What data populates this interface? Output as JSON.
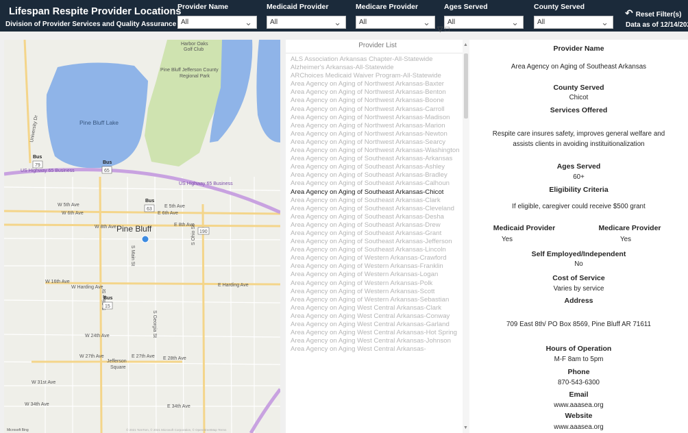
{
  "header": {
    "title": "Lifespan Respite Provider Locations",
    "subtitle": "Division of Provider Services and Quality Assurance",
    "reset_label": "Reset Filter(s)",
    "data_as_of": "Data as of 12/14/2021"
  },
  "slicers": [
    {
      "label": "Provider Name",
      "value": "All"
    },
    {
      "label": "Medicaid Provider",
      "value": "All"
    },
    {
      "label": "Medicare Provider",
      "value": "All"
    },
    {
      "label": "Ages Served",
      "value": "All"
    },
    {
      "label": "County Served",
      "value": "All"
    }
  ],
  "map": {
    "labels": {
      "harbor": "Harbor Oaks",
      "golf": "Golf Club",
      "park1": "Pine Bluff Jefferson County",
      "park2": "Regional Park",
      "lake": "Pine Bluff Lake",
      "city": "Pine Bluff",
      "hwy1": "US Highway 65 Business",
      "hwy2": "US Highway 65 Business",
      "w5": "W 5th Ave",
      "w6": "W 6th Ave",
      "e5": "E 5th Ave",
      "e6": "E 6th Ave",
      "w8": "W 8th Ave",
      "e8": "E 8th Ave",
      "w16": "W 16th Ave",
      "harding": "W Harding Ave",
      "eharding": "E Harding Ave",
      "w24": "W 24th Ave",
      "w27": "W 27th Ave",
      "e27": "E 27th Ave",
      "e28": "E 28th Ave",
      "jeff1": "Jefferson",
      "jeff2": "Square",
      "w31": "W 31st Ave",
      "w34": "W 34th Ave",
      "e34": "E 34th Ave",
      "univ": "University Dr",
      "mainst": "S Main St",
      "ohio": "S Ohio St",
      "olive": "S Olive St",
      "georgia": "S Georgia St",
      "bus": "Bus",
      "sh79": "79",
      "sh65": "65",
      "sh63": "63",
      "sh190": "190",
      "sh15": "15",
      "ms": "Microsoft Bing",
      "copyright": "© 2021 TomTom, © 2021 Microsoft Corporation, © OpenStreetMap Terms"
    }
  },
  "provider_list": {
    "header": "Provider List",
    "selected": "Area Agency on Aging of Southeast Arkansas-Chicot",
    "items": [
      "ALS Association Arkansas Chapter-All-Statewide",
      "Alzheimer's Arkansas-All-Statewide",
      "ARChoices Medicaid Waiver Program-All-Statewide",
      "Area Agency on Aging of Northwest Arkansas-Baxter",
      "Area Agency on Aging of Northwest Arkansas-Benton",
      "Area Agency on Aging of Northwest Arkansas-Boone",
      "Area Agency on Aging of Northwest Arkansas-Carroll",
      "Area Agency on Aging of Northwest Arkansas-Madison",
      "Area Agency on Aging of Northwest Arkansas-Marion",
      "Area Agency on Aging of Northwest Arkansas-Newton",
      "Area Agency on Aging of Northwest Arkansas-Searcy",
      "Area Agency on Aging of Northwest Arkansas-Washington",
      "Area Agency on Aging of Southeast Arkansas-Arkansas",
      "Area Agency on Aging of Southeast Arkansas-Ashley",
      "Area Agency on Aging of Southeast Arkansas-Bradley",
      "Area Agency on Aging of Southeast Arkansas-Calhoun",
      "Area Agency on Aging of Southeast Arkansas-Chicot",
      "Area Agency on Aging of Southeast Arkansas-Clark",
      "Area Agency on Aging of Southeast Arkansas-Cleveland",
      "Area Agency on Aging of Southeast Arkansas-Desha",
      "Area Agency on Aging of Southeast Arkansas-Drew",
      "Area Agency on Aging of Southeast Arkansas-Grant",
      "Area Agency on Aging of Southeast Arkansas-Jefferson",
      "Area Agency on Aging of Southeast Arkansas-Lincoln",
      "Area Agency on Aging of Western Arkansas-Crawford",
      "Area Agency on Aging of Western Arkansas-Franklin",
      "Area Agency on Aging of Western Arkansas-Logan",
      "Area Agency on Aging of Western Arkansas-Polk",
      "Area Agency on Aging of Western Arkansas-Scott",
      "Area Agency on Aging of Western Arkansas-Sebastian",
      "Area Agency on Aging West Central Arkansas-Clark",
      "Area Agency on Aging West Central Arkansas-Conway",
      "Area Agency on Aging West Central Arkansas-Garland",
      "Area Agency on Aging West Central Arkansas-Hot Spring",
      "Area Agency on Aging West Central Arkansas-Johnson",
      "Area Agency on Aging West Central Arkansas-"
    ]
  },
  "details": {
    "provider_name_label": "Provider Name",
    "provider_name": "Area Agency on Aging of Southeast Arkansas",
    "county_label": "County Served",
    "county": "Chicot",
    "services_label": "Services Offered",
    "services": "Respite care insures safety, improves general welfare and assists clients in avoiding instituitionalization",
    "ages_label": "Ages Served",
    "ages": "60+",
    "eligibility_label": "Eligibility Criteria",
    "eligibility": "If eligible, caregiver could receive $500 grant",
    "medicaid_label": "Medicaid Provider",
    "medicaid": "Yes",
    "medicare_label": "Medicare Provider",
    "medicare": "Yes",
    "self_employed_label": "Self Employed/Independent",
    "self_employed": "No",
    "cost_label": "Cost of Service",
    "cost": "Varies by service",
    "address_label": "Address",
    "address": "709 East 8th/ PO Box 8569, Pine Bluff AR 71611",
    "hours_label": "Hours of Operation",
    "hours": "M-F 8am to 5pm",
    "phone_label": "Phone",
    "phone": "870-543-6300",
    "email_label": "Email",
    "email": "www.aaasea.org",
    "website_label": "Website",
    "website": "www.aaasea.org"
  },
  "colors": {
    "header_bg": "#1b2a3a",
    "lake": "#8fb4e8",
    "park": "#cfe3b0",
    "highway": "#c8a2e0",
    "road_major": "#f4d58a",
    "marker": "#3d8be0"
  }
}
